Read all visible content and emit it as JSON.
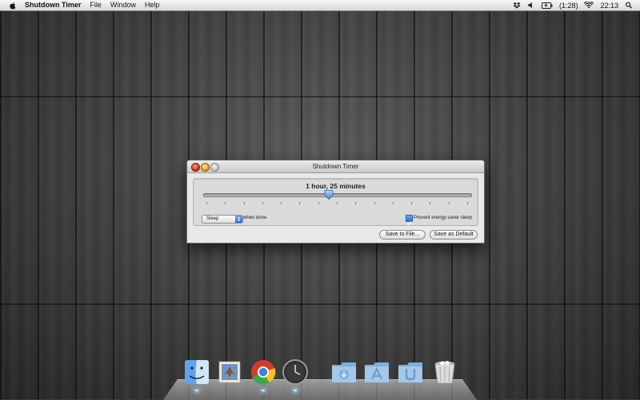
{
  "menubar": {
    "apple_icon": "apple-logo-icon",
    "app_name": "Shutdown Timer",
    "menus": [
      "File",
      "Window",
      "Help"
    ],
    "status": {
      "battery_text": "(1:28)",
      "clock": "22:13",
      "icons": [
        "dropbox-icon",
        "volume-icon",
        "battery-icon",
        "wifi-icon",
        "spotlight-icon"
      ]
    }
  },
  "window": {
    "title": "Shutdown Timer",
    "time_label": "1 hour, 25 minutes",
    "slider_fraction": 0.47,
    "tick_count": 15,
    "action_select": "Sleep",
    "when_done_label": "when done",
    "prevent_sleep_checked": true,
    "prevent_sleep_label": "Prevent energy saver sleep",
    "buttons": {
      "save_to_file": "Save to File...",
      "save_as_default": "Save as Default"
    }
  },
  "dock": {
    "items": [
      {
        "name": "finder-icon",
        "running": true
      },
      {
        "name": "mail-icon",
        "running": false
      },
      {
        "name": "chrome-icon",
        "running": true
      },
      {
        "name": "clock-icon",
        "running": true
      },
      {
        "name": "downloads-folder-icon",
        "running": false
      },
      {
        "name": "applications-folder-icon",
        "running": false
      },
      {
        "name": "utilities-folder-icon",
        "running": false
      },
      {
        "name": "trash-icon",
        "running": false
      }
    ]
  },
  "colors": {
    "accent_blue": "#2b6bd3",
    "close_red": "#d8321e",
    "minimize_yellow": "#e4a21c"
  }
}
